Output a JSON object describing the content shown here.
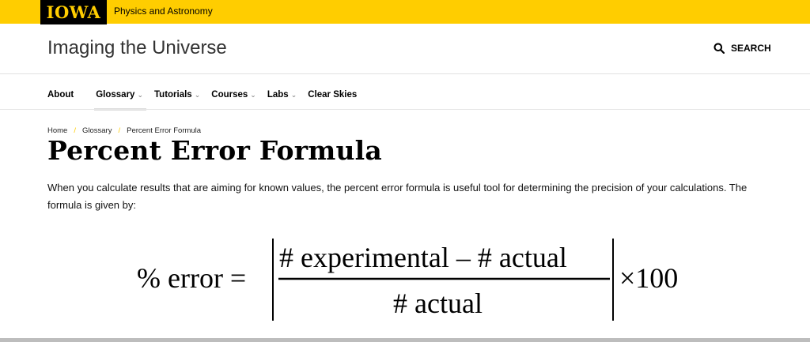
{
  "brand": {
    "logo": "IOWA",
    "department": "Physics and Astronomy"
  },
  "header": {
    "site_title": "Imaging the Universe",
    "search_label": "SEARCH"
  },
  "nav": {
    "items": [
      {
        "label": "About"
      },
      {
        "label": "Glossary",
        "active": true
      },
      {
        "label": "Tutorials"
      },
      {
        "label": "Courses"
      },
      {
        "label": "Labs"
      },
      {
        "label": "Clear Skies"
      }
    ]
  },
  "breadcrumb": {
    "items": [
      "Home",
      "Glossary",
      "Percent Error Formula"
    ],
    "separator": "/"
  },
  "page": {
    "title": "Percent Error Formula",
    "intro": "When you calculate results that are aiming for known values, the percent error formula is useful tool for determining the precision of your calculations. The formula is given by:"
  },
  "formula": {
    "lhs": "% error =",
    "numerator": "# experimental – # actual",
    "denominator": "# actual",
    "multiplier": "×100"
  },
  "colors": {
    "brand_yellow": "#ffcd00",
    "brand_black": "#000000"
  }
}
